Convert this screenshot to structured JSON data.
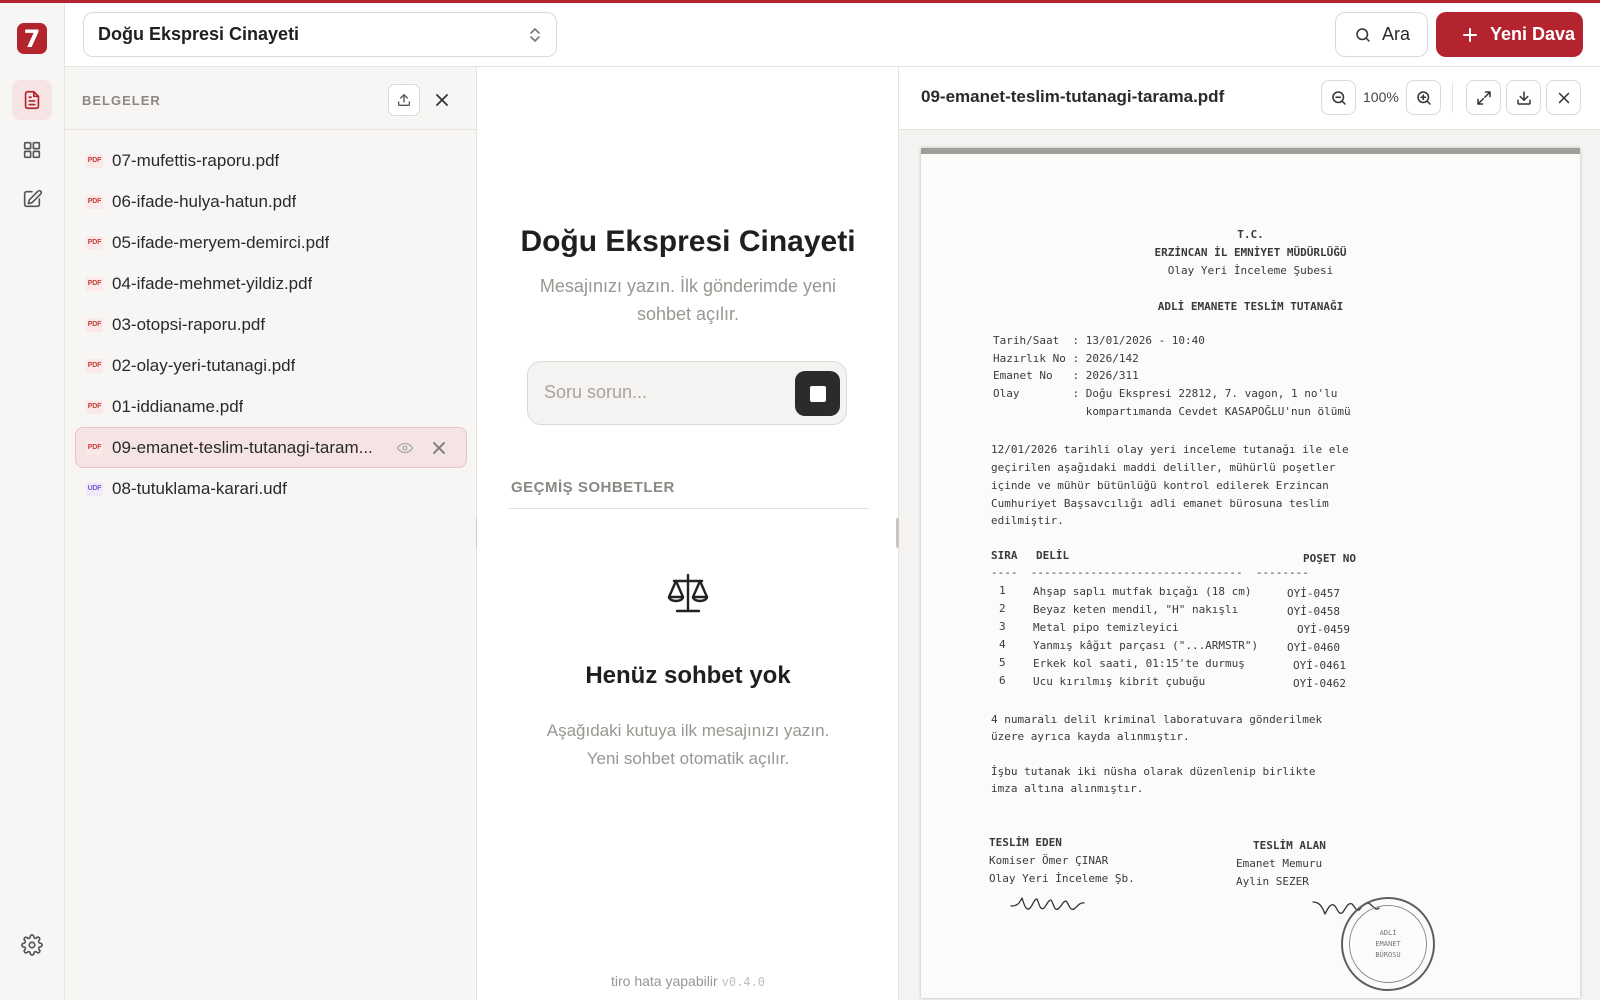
{
  "app": {
    "logo_char": "7",
    "accent_color": "#b3242f"
  },
  "topbar": {
    "case_name": "Doğu Ekspresi Cinayeti",
    "search_label": "Ara",
    "new_case_label": "Yeni Dava"
  },
  "documents": {
    "title": "BELGELER",
    "items": [
      {
        "name": "07-mufettis-raporu.pdf",
        "type": "PDF"
      },
      {
        "name": "06-ifade-hulya-hatun.pdf",
        "type": "PDF"
      },
      {
        "name": "05-ifade-meryem-demirci.pdf",
        "type": "PDF"
      },
      {
        "name": "04-ifade-mehmet-yildiz.pdf",
        "type": "PDF"
      },
      {
        "name": "03-otopsi-raporu.pdf",
        "type": "PDF"
      },
      {
        "name": "02-olay-yeri-tutanagi.pdf",
        "type": "PDF"
      },
      {
        "name": "01-iddianame.pdf",
        "type": "PDF"
      },
      {
        "name": "09-emanet-teslim-tutanagi-taram...",
        "type": "PDF",
        "selected": true
      },
      {
        "name": "08-tutuklama-karari.udf",
        "type": "UDF"
      }
    ]
  },
  "chat": {
    "title": "Doğu Ekspresi Cinayeti",
    "subtitle": "Mesajınızı yazın. İlk gönderimde yeni sohbet açılır.",
    "input_placeholder": "Soru sorun...",
    "history_label": "GEÇMİŞ SOHBETLER",
    "empty_title": "Henüz sohbet yok",
    "empty_subtitle": "Aşağıdaki kutuya ilk mesajınızı yazın. Yeni sohbet otomatik açılır.",
    "footnote": "tiro hata yapabilir",
    "version": "v0.4.0"
  },
  "viewer": {
    "file_name": "09-emanet-teslim-tutanagi-tarama.pdf",
    "zoom": "100%",
    "document": {
      "header1": "T.C.",
      "header2": "ERZİNCAN İL EMNİYET MÜDÜRLÜĞÜ",
      "header3": "Olay Yeri İnceleme Şubesi",
      "doc_title": "ADLİ EMANETE TESLİM TUTANAĞI",
      "fields": [
        "Tarih/Saat  : 13/01/2026 - 10:40",
        "Hazırlık No : 2026/142",
        "Emanet No   : 2026/311",
        "Olay        : Doğu Ekspresi 22812, 7. vagon, 1 no'lu",
        "              kompartımanda Cevdet KASAPOĞLU'nun ölümü"
      ],
      "paragraph1": [
        "12/01/2026 tarihli olay yeri inceleme tutanağı ile ele",
        "geçirilen aşağıdaki maddi deliller, mühürlü poşetler",
        "içinde ve mühür bütünlüğü kontrol edilerek Erzincan",
        "Cumhuriyet Başsavcılığı adli emanet bürosuna teslim",
        "edilmiştir."
      ],
      "table_header": {
        "no": "SIRA",
        "item": "DELİL",
        "bag": "POŞET NO"
      },
      "table_rule": "----  --------------------------------  --------",
      "table_rows": [
        {
          "no": "1",
          "item": "Ahşap saplı mutfak bıçağı (18 cm)",
          "bag": "OYİ-0457"
        },
        {
          "no": "2",
          "item": "Beyaz keten mendil, \"H\" nakışlı",
          "bag": "OYİ-0458"
        },
        {
          "no": "3",
          "item": "Metal pipo temizleyici",
          "bag": "OYİ-0459"
        },
        {
          "no": "4",
          "item": "Yanmış kâğıt parçası (\"...ARMSTR\")",
          "bag": "OYİ-0460"
        },
        {
          "no": "5",
          "item": "Erkek kol saati, 01:15'te durmuş",
          "bag": "OYİ-0461"
        },
        {
          "no": "6",
          "item": "Ucu kırılmış kibrit çubuğu",
          "bag": "OYİ-0462"
        }
      ],
      "paragraph2": [
        "4 numaralı delil kriminal laboratuvara gönderilmek",
        "üzere ayrıca kayda alınmıştır."
      ],
      "paragraph3": [
        "İşbu tutanak iki nüsha olarak düzenlenip birlikte",
        "imza altına alınmıştır."
      ],
      "giver": {
        "heading": "TESLİM EDEN",
        "line1": "Komiser Ömer ÇINAR",
        "line2": "Olay Yeri İnceleme Şb."
      },
      "receiver": {
        "heading": "TESLİM ALAN",
        "line1": "Emanet Memuru",
        "line2": "Aylin SEZER"
      },
      "stamp": [
        "ADLİ",
        "EMANET",
        "BÜROSU"
      ]
    }
  }
}
